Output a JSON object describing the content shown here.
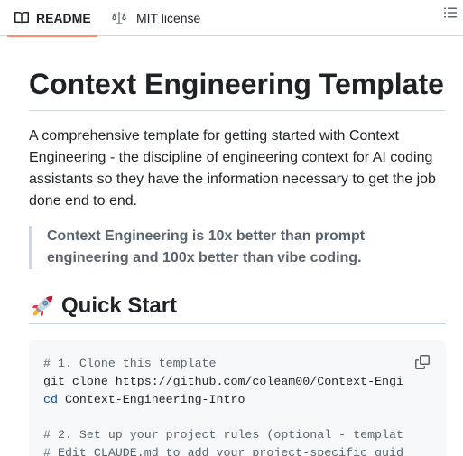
{
  "tabs": {
    "readme_label": "README",
    "license_label": "MIT license",
    "active": "README",
    "accent_color": "#fd8c73"
  },
  "icons": {
    "readme": "book-icon",
    "license": "law-scale-icon",
    "outline": "list-unordered-icon",
    "copy": "copy-icon",
    "heading_emoji": "rocket-emoji"
  },
  "readme": {
    "title": "Context Engineering Template",
    "intro": "A comprehensive template for getting started with Context Engineering - the discipline of engineering context for AI coding assistants so they have the information necessary to get the job done end to end.",
    "quote": "Context Engineering is 10x better than prompt engineering and 100x better than vibe coding.",
    "quick_start_heading": "Quick Start",
    "code": {
      "comment_1": "# 1. Clone this template",
      "line_1": "git clone https://github.com/coleam00/Context-Engi",
      "cd_keyword": "cd",
      "line_2_rest": " Context-Engineering-Intro",
      "comment_2": "# 2. Set up your project rules (optional - templat",
      "comment_3": "# Edit CLAUDE.md to add your project-specific guid"
    }
  }
}
